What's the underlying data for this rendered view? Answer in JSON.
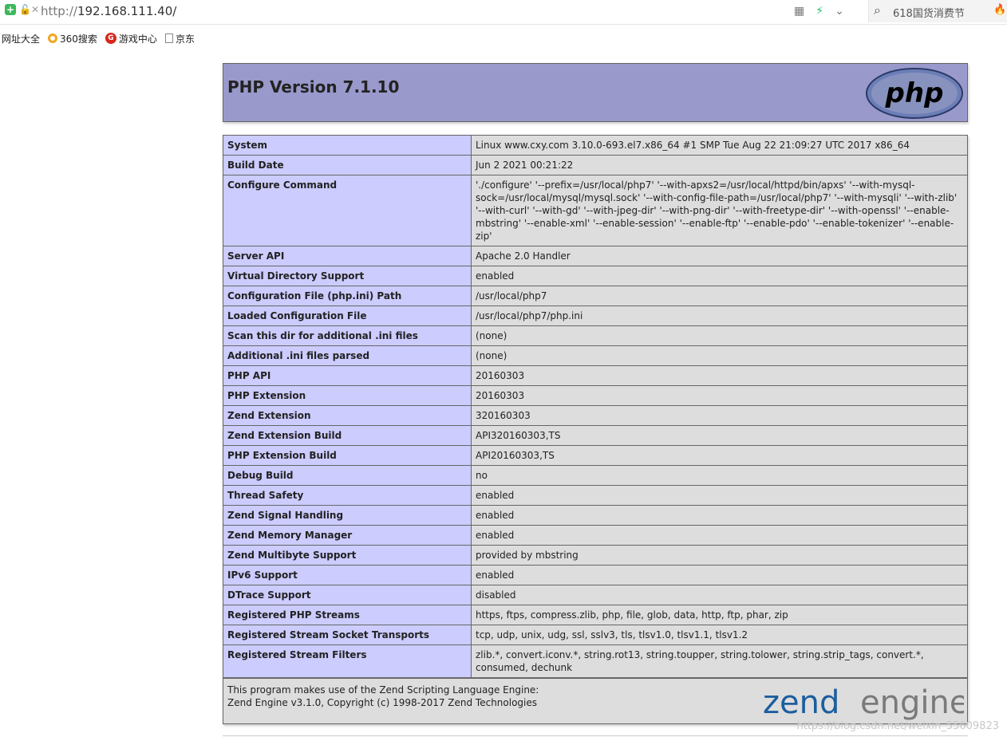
{
  "browser": {
    "url_prefix": "http://",
    "url_host": "192.168.111.40/",
    "search_placeholder": "618国货消费节",
    "bookmarks": [
      "网址大全",
      "360搜索",
      "游戏中心",
      "京东"
    ]
  },
  "php": {
    "title": "PHP Version 7.1.10",
    "logo_text": "php",
    "rows": [
      {
        "key": "System",
        "value": "Linux www.cxy.com 3.10.0-693.el7.x86_64 #1 SMP Tue Aug 22 21:09:27 UTC 2017 x86_64"
      },
      {
        "key": "Build Date",
        "value": "Jun 2 2021 00:21:22"
      },
      {
        "key": "Configure Command",
        "value": "'./configure' '--prefix=/usr/local/php7' '--with-apxs2=/usr/local/httpd/bin/apxs' '--with-mysql-sock=/usr/local/mysql/mysql.sock' '--with-config-file-path=/usr/local/php7' '--with-mysqli' '--with-zlib' '--with-curl' '--with-gd' '--with-jpeg-dir' '--with-png-dir' '--with-freetype-dir' '--with-openssl' '--enable-mbstring' '--enable-xml' '--enable-session' '--enable-ftp' '--enable-pdo' '--enable-tokenizer' '--enable-zip'"
      },
      {
        "key": "Server API",
        "value": "Apache 2.0 Handler"
      },
      {
        "key": "Virtual Directory Support",
        "value": "enabled"
      },
      {
        "key": "Configuration File (php.ini) Path",
        "value": "/usr/local/php7"
      },
      {
        "key": "Loaded Configuration File",
        "value": "/usr/local/php7/php.ini"
      },
      {
        "key": "Scan this dir for additional .ini files",
        "value": "(none)"
      },
      {
        "key": "Additional .ini files parsed",
        "value": "(none)"
      },
      {
        "key": "PHP API",
        "value": "20160303"
      },
      {
        "key": "PHP Extension",
        "value": "20160303"
      },
      {
        "key": "Zend Extension",
        "value": "320160303"
      },
      {
        "key": "Zend Extension Build",
        "value": "API320160303,TS"
      },
      {
        "key": "PHP Extension Build",
        "value": "API20160303,TS"
      },
      {
        "key": "Debug Build",
        "value": "no"
      },
      {
        "key": "Thread Safety",
        "value": "enabled"
      },
      {
        "key": "Zend Signal Handling",
        "value": "enabled"
      },
      {
        "key": "Zend Memory Manager",
        "value": "enabled"
      },
      {
        "key": "Zend Multibyte Support",
        "value": "provided by mbstring"
      },
      {
        "key": "IPv6 Support",
        "value": "enabled"
      },
      {
        "key": "DTrace Support",
        "value": "disabled"
      },
      {
        "key": "Registered PHP Streams",
        "value": "https, ftps, compress.zlib, php, file, glob, data, http, ftp, phar, zip"
      },
      {
        "key": "Registered Stream Socket Transports",
        "value": "tcp, udp, unix, udg, ssl, sslv3, tls, tlsv1.0, tlsv1.1, tlsv1.2"
      },
      {
        "key": "Registered Stream Filters",
        "value": "zlib.*, convert.iconv.*, string.rot13, string.toupper, string.tolower, string.strip_tags, convert.*, consumed, dechunk"
      }
    ],
    "footer_line1": "This program makes use of the Zend Scripting Language Engine:",
    "footer_line2": "Zend Engine v3.1.0, Copyright (c) 1998-2017 Zend Technologies",
    "zend_logo_left": "zend",
    "zend_logo_right": "engine"
  },
  "watermark": "https://blog.csdn.net/weixin_55609823",
  "colors": {
    "header_bg": "#9999cc",
    "key_bg": "#ccccff",
    "value_bg": "#dddddd"
  }
}
